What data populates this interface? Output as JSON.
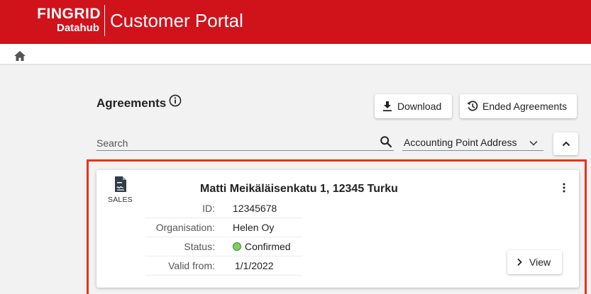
{
  "header": {
    "logo_main": "FINGRID",
    "logo_sub": "Datahub",
    "portal_title": "Customer Portal",
    "brand_color": "#d0121b"
  },
  "breadcrumb": {
    "home_icon": "home-icon"
  },
  "agreements": {
    "title": "Agreements",
    "info_icon": "info-icon",
    "download_label": "Download",
    "ended_label": "Ended Agreements",
    "search_placeholder": "Search",
    "sort_by_value": "Accounting Point Address",
    "sort_direction_icon": "chevron-up-icon"
  },
  "card": {
    "type_label": "SALES",
    "type_icon": "contract-document-icon",
    "address": "Matti Meikäläisenkatu 1, 12345 Turku",
    "fields": [
      {
        "label": "ID:",
        "value": "12345678"
      },
      {
        "label": "Organisation:",
        "value": "Helen Oy"
      },
      {
        "label": "Status:",
        "value": "Confirmed"
      },
      {
        "label": "Valid from:",
        "value": "1/1/2022"
      }
    ],
    "status_color": "#7ed05f",
    "view_label": "View",
    "highlight_color": "#e8321c"
  }
}
